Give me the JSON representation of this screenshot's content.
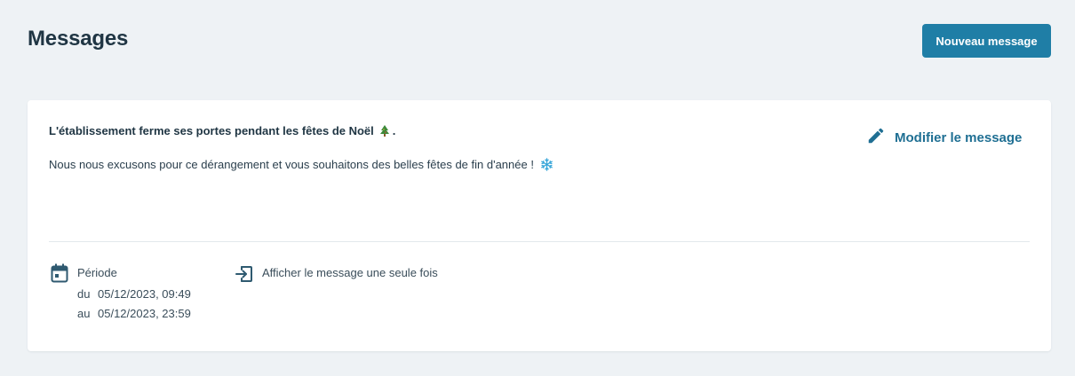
{
  "header": {
    "title": "Messages",
    "new_button_label": "Nouveau message"
  },
  "message": {
    "title": "L'établissement ferme ses portes pendant les fêtes de Noël",
    "title_suffix": ".",
    "title_emoji_icon": "christmas-tree-icon",
    "body": "Nous nous excusons pour ce dérangement et vous souhaitons des belles fêtes de fin d'année !",
    "body_emoji_icon": "snowflake-icon",
    "edit_label": "Modifier le message"
  },
  "period": {
    "label": "Période",
    "from_prefix": "du",
    "from_value": "05/12/2023, 09:49",
    "to_prefix": "au",
    "to_value": "05/12/2023, 23:59"
  },
  "display_once": {
    "label": "Afficher le message une seule fois"
  },
  "colors": {
    "background": "#eef2f5",
    "primary": "#1f7ea6",
    "link": "#1f6f93",
    "text": "#1f3543"
  }
}
